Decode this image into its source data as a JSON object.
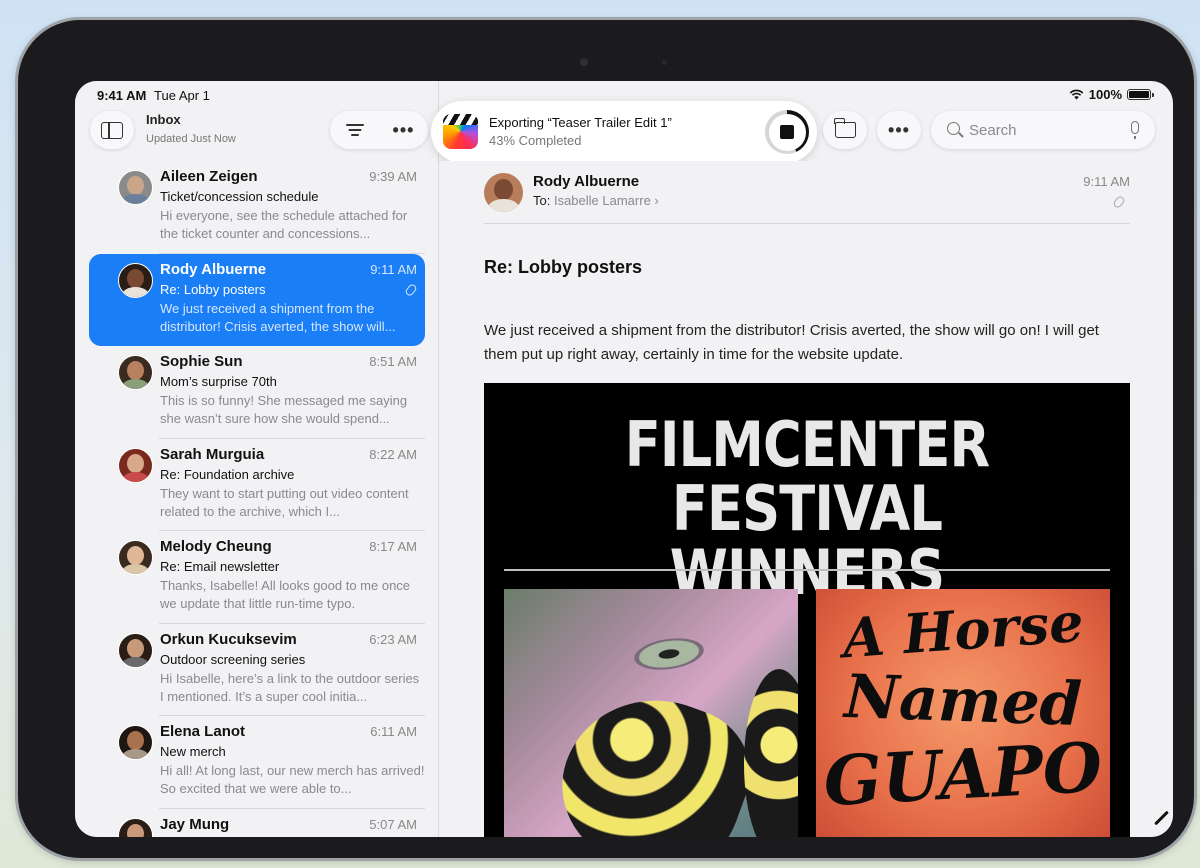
{
  "status_bar": {
    "time": "9:41 AM",
    "date": "Tue Apr 1",
    "battery": "100%"
  },
  "sidebar": {
    "title": "Inbox",
    "subtitle": "Updated Just Now",
    "mails": [
      {
        "sender": "Aileen Zeigen",
        "time": "9:39 AM",
        "subject": "Ticket/concession schedule",
        "preview": "Hi everyone, see the schedule attached for the ticket counter and concessions...",
        "selected": false,
        "skin": "#c9a58a",
        "hair": "#8a8a8a",
        "shirt": "#6b7f9a"
      },
      {
        "sender": "Rody Albuerne",
        "time": "9:11 AM",
        "subject": "Re: Lobby posters",
        "preview": "We just received a shipment from the distributor! Crisis averted, the show will...",
        "selected": true,
        "skin": "#7a4a33",
        "hair": "#2a1d15",
        "shirt": "#e8e2d8"
      },
      {
        "sender": "Sophie Sun",
        "time": "8:51 AM",
        "subject": "Mom’s surprise 70th",
        "preview": "This is so funny! She messaged me saying she wasn’t sure how she would spend...",
        "selected": false,
        "skin": "#b98060",
        "hair": "#3a2a20",
        "shirt": "#8aa07a"
      },
      {
        "sender": "Sarah Murguia",
        "time": "8:22 AM",
        "subject": "Re: Foundation archive",
        "preview": "They want to start putting out video content related to the archive, which I...",
        "selected": false,
        "skin": "#d7a88a",
        "hair": "#7a2a1d",
        "shirt": "#c94a4a"
      },
      {
        "sender": "Melody Cheung",
        "time": "8:17 AM",
        "subject": "Re: Email newsletter",
        "preview": "Thanks, Isabelle! All looks good to me once we update that little run-time typo.",
        "selected": false,
        "skin": "#e0b898",
        "hair": "#3a2a20",
        "shirt": "#d9c7a8"
      },
      {
        "sender": "Orkun Kucuksevim",
        "time": "6:23 AM",
        "subject": "Outdoor screening series",
        "preview": "Hi Isabelle, here’s a link to the outdoor series I mentioned. It’s a super cool initia...",
        "selected": false,
        "skin": "#c99a7a",
        "hair": "#2a1d15",
        "shirt": "#6a6a6a"
      },
      {
        "sender": "Elena Lanot",
        "time": "6:11 AM",
        "subject": "New merch",
        "preview": "Hi all! At long last, our new merch has arrived! So excited that we were able to...",
        "selected": false,
        "skin": "#a8724f",
        "hair": "#1f1612",
        "shirt": "#a89888"
      },
      {
        "sender": "Jay Mung",
        "time": "5:07 AM",
        "subject": "",
        "preview": "",
        "selected": false,
        "skin": "#c99a7a",
        "hair": "#2a1d15",
        "shirt": "#5a6a7a"
      }
    ]
  },
  "export": {
    "title": "Exporting “Teaser Trailer Edit 1”",
    "progress_label": "43% Completed",
    "progress": 0.43
  },
  "search": {
    "placeholder": "Search"
  },
  "reader": {
    "sender": "Rody Albuerne",
    "to_label": "To:",
    "to_name": "Isabelle Lamarre",
    "time": "9:11 AM",
    "subject": "Re: Lobby posters",
    "body": "We just received a shipment from the distributor! Crisis averted, the show will go on! I will get them put up right away, certainly in time for the website update.",
    "poster": {
      "line1": "FILMCENTER",
      "line2": "FESTIVAL WINNERS",
      "film_title_1": "A Horse",
      "film_title_2": "Named",
      "film_title_3": "GUAPO"
    }
  },
  "colors": {
    "accent": "#1a7ef7"
  }
}
